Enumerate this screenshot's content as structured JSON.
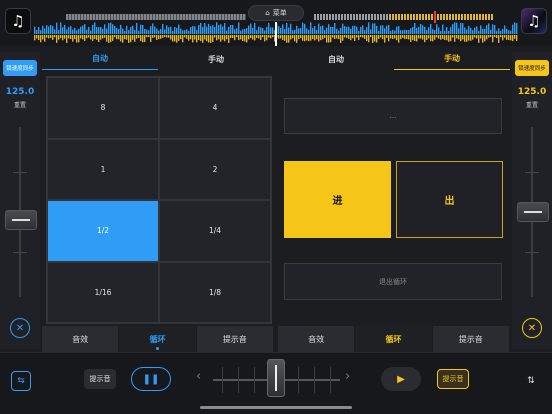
{
  "header": {
    "menu_label": "菜单",
    "menu_icon": "home-icon",
    "left_cover_icon": "music-note-icon",
    "right_cover_icon": "music-note-icon"
  },
  "colors": {
    "deck_left_accent": "#2f9cf5",
    "deck_right_accent": "#f5c518",
    "background": "#1c1d21"
  },
  "left_side": {
    "sync_label": "锁速度同步",
    "bpm": "125.0",
    "reset_label": "重置",
    "close_icon": "close-icon"
  },
  "right_side": {
    "sync_label": "锁速度同步",
    "bpm": "125.0",
    "reset_label": "重置",
    "close_icon": "close-icon"
  },
  "deck_left": {
    "tabs": [
      {
        "label": "自动",
        "active": true
      },
      {
        "label": "手动",
        "active": false
      }
    ],
    "loop_sizes": [
      "8",
      "4",
      "1",
      "2",
      "1/2",
      "1/4",
      "1/16",
      "1/8"
    ],
    "selected_loop": "1/2",
    "bottom_tabs": [
      {
        "label": "音效",
        "active": false
      },
      {
        "label": "循环",
        "active": true
      },
      {
        "label": "提示音",
        "active": false
      }
    ]
  },
  "deck_right": {
    "tabs": [
      {
        "label": "自动",
        "active": false
      },
      {
        "label": "手动",
        "active": true
      }
    ],
    "display_text": "...",
    "in_label": "进",
    "out_label": "出",
    "exit_label": "退出循环",
    "bottom_tabs": [
      {
        "label": "音效",
        "active": false
      },
      {
        "label": "循环",
        "active": true
      },
      {
        "label": "提示音",
        "active": false
      }
    ]
  },
  "transport": {
    "left_cue_label": "提示音",
    "left_play_icon": "pause-icon",
    "right_play_icon": "play-icon",
    "right_cue_label": "提示音",
    "eq_left_icon": "eq-sliders-icon",
    "eq_right_icon": "eq-sliders-icon",
    "crossfader_position": 0.5
  }
}
